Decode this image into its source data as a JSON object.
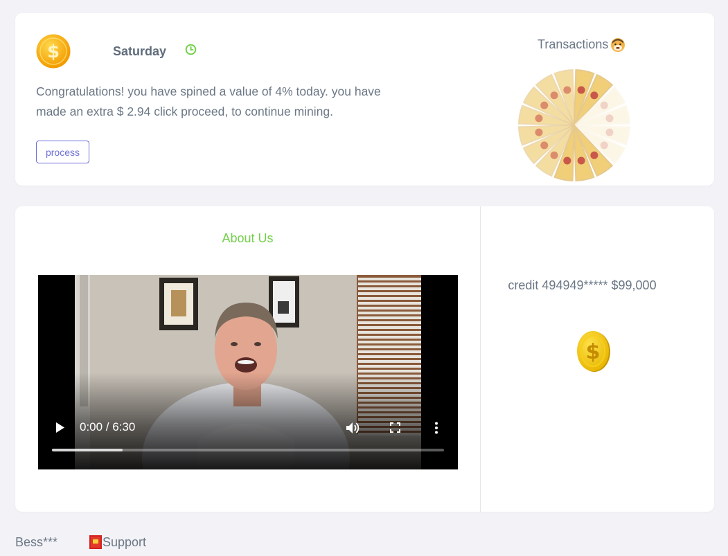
{
  "header": {
    "day": "Saturday",
    "message": "Congratulations! you have spined a value of 4% today. you have made an extra $ 2.94 click proceed, to continue mining.",
    "process_button": "process"
  },
  "about": {
    "title": "About Us"
  },
  "video": {
    "time": "0:00 / 6:30",
    "progress": 0.18
  },
  "transactions": {
    "title": "Transactions",
    "credit": "credit 494949***** $99,000"
  },
  "footer": {
    "user": "Bess***",
    "support": "Support"
  },
  "colors": {
    "accent_green": "#72d04a",
    "button_purple": "#6c6fd4",
    "text_gray": "#6b7785"
  }
}
